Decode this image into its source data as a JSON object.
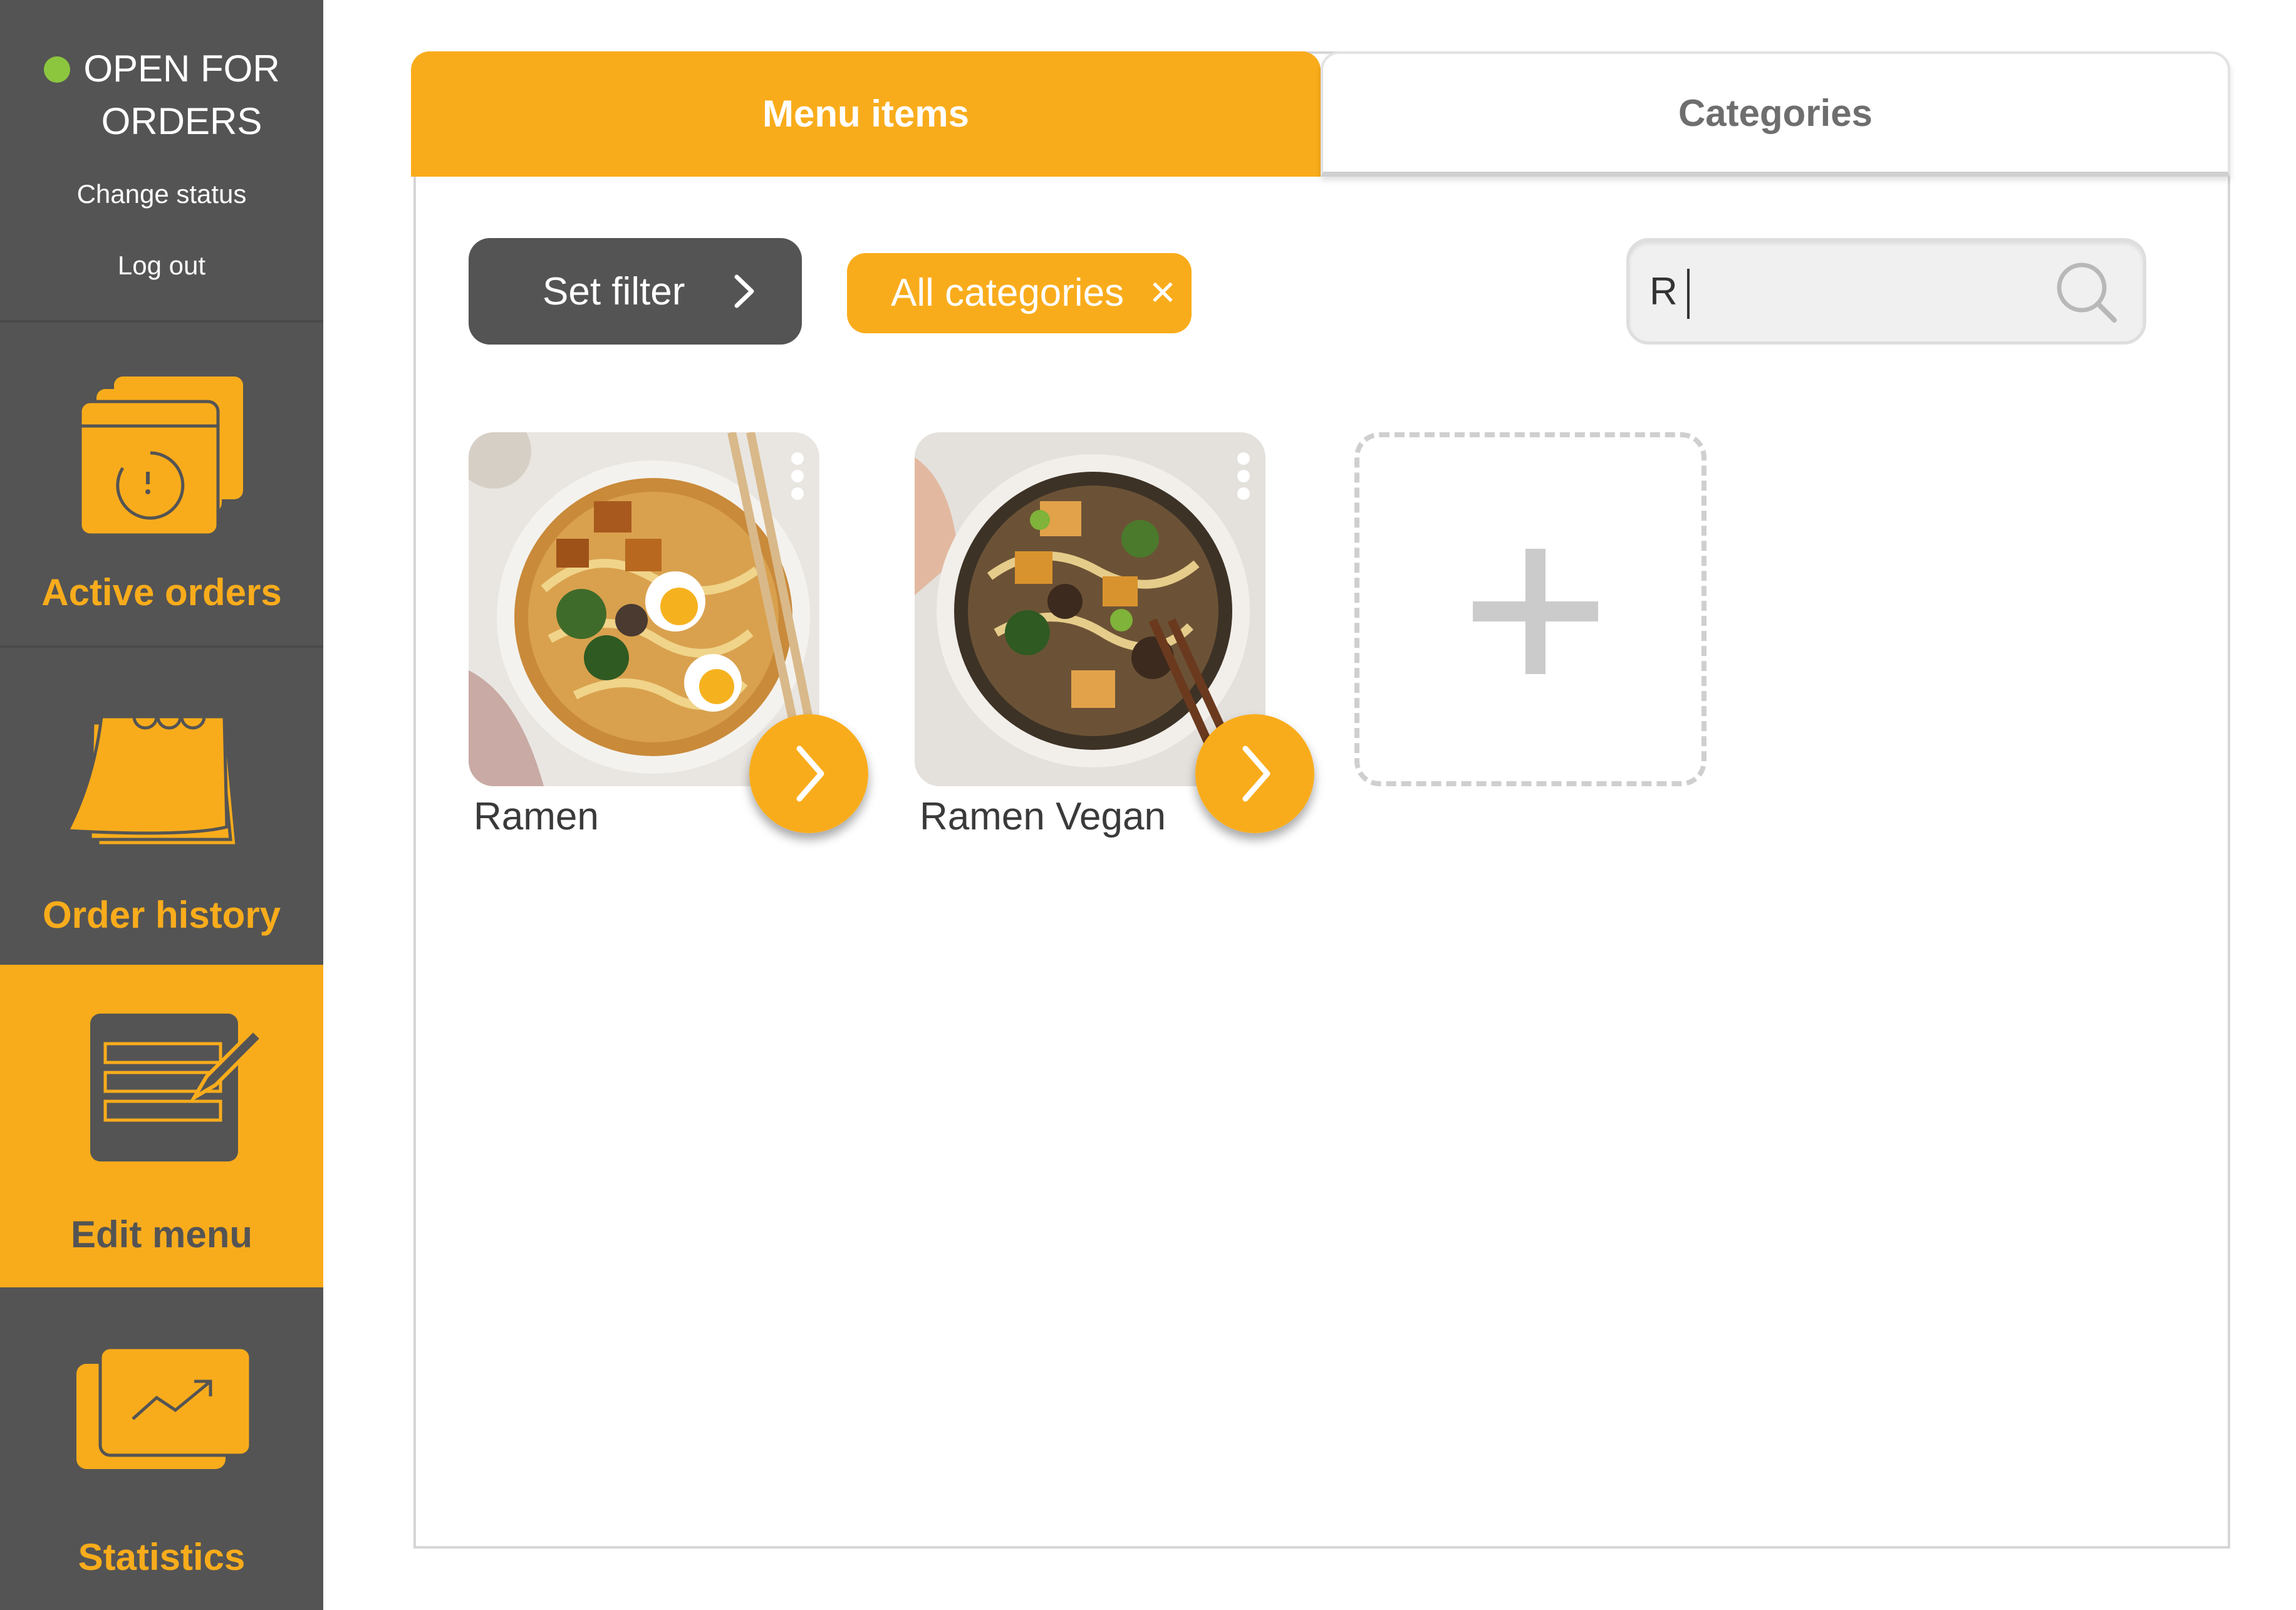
{
  "colors": {
    "accent": "#F9AC1B",
    "sidebar_bg": "#545454",
    "dark_button": "#545454",
    "status_dot": "#8CC63F",
    "icon_stroke": "#545454"
  },
  "sidebar": {
    "status_line1": "OPEN FOR",
    "status_line2": "ORDERS",
    "change_status": "Change status",
    "log_out": "Log out",
    "nav": [
      {
        "label": "Active orders",
        "icon": "active-orders-icon"
      },
      {
        "label": "Order history",
        "icon": "calendar-icon"
      },
      {
        "label": "Edit menu",
        "icon": "edit-menu-icon",
        "active": true
      },
      {
        "label": "Statistics",
        "icon": "statistics-icon"
      }
    ]
  },
  "tabs": {
    "menu_items": "Menu  items",
    "categories": "Categories",
    "active": "menu_items"
  },
  "toolbar": {
    "set_filter": "Set filter",
    "category_chip": "All categories",
    "search_value": "R"
  },
  "items": [
    {
      "name": "Ramen",
      "image": "ramen-photo"
    },
    {
      "name": "Ramen Vegan",
      "image": "ramen-vegan-photo"
    }
  ]
}
